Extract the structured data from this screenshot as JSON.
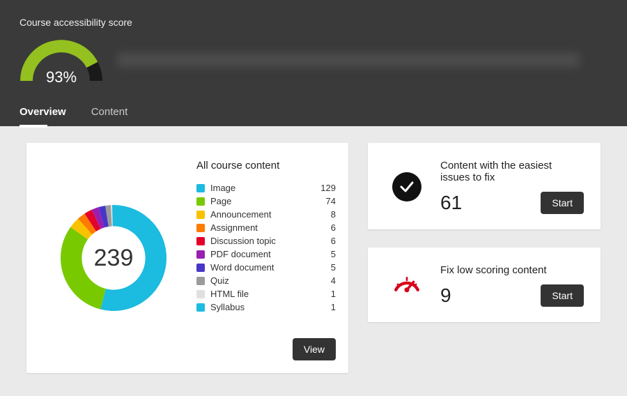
{
  "header": {
    "title": "Course accessibility score",
    "score_pct": "93%",
    "course_name_blurred": true
  },
  "tabs": [
    {
      "label": "Overview",
      "active": true
    },
    {
      "label": "Content",
      "active": false
    }
  ],
  "content_card": {
    "title": "All course content",
    "total": "239",
    "view_label": "View",
    "items": [
      {
        "label": "Image",
        "count": "129",
        "color": "#1cbbe0"
      },
      {
        "label": "Page",
        "count": "74",
        "color": "#79c900"
      },
      {
        "label": "Announcement",
        "count": "8",
        "color": "#f9c200"
      },
      {
        "label": "Assignment",
        "count": "6",
        "color": "#ff7a00"
      },
      {
        "label": "Discussion topic",
        "count": "6",
        "color": "#e3002b"
      },
      {
        "label": "PDF document",
        "count": "5",
        "color": "#9a1fb0"
      },
      {
        "label": "Word document",
        "count": "5",
        "color": "#4836c9"
      },
      {
        "label": "Quiz",
        "count": "4",
        "color": "#9b9b9b"
      },
      {
        "label": "HTML file",
        "count": "1",
        "color": "#e0e0e0"
      },
      {
        "label": "Syllabus",
        "count": "1",
        "color": "#1cbbe0"
      }
    ]
  },
  "easy_card": {
    "title": "Content with the easiest issues to fix",
    "count": "61",
    "start_label": "Start"
  },
  "low_card": {
    "title": "Fix low scoring content",
    "count": "9",
    "start_label": "Start"
  },
  "chart_data": {
    "type": "pie",
    "title": "All course content",
    "total": 239,
    "series": [
      {
        "name": "Image",
        "value": 129
      },
      {
        "name": "Page",
        "value": 74
      },
      {
        "name": "Announcement",
        "value": 8
      },
      {
        "name": "Assignment",
        "value": 6
      },
      {
        "name": "Discussion topic",
        "value": 6
      },
      {
        "name": "PDF document",
        "value": 5
      },
      {
        "name": "Word document",
        "value": 5
      },
      {
        "name": "Quiz",
        "value": 4
      },
      {
        "name": "HTML file",
        "value": 1
      },
      {
        "name": "Syllabus",
        "value": 1
      }
    ]
  }
}
